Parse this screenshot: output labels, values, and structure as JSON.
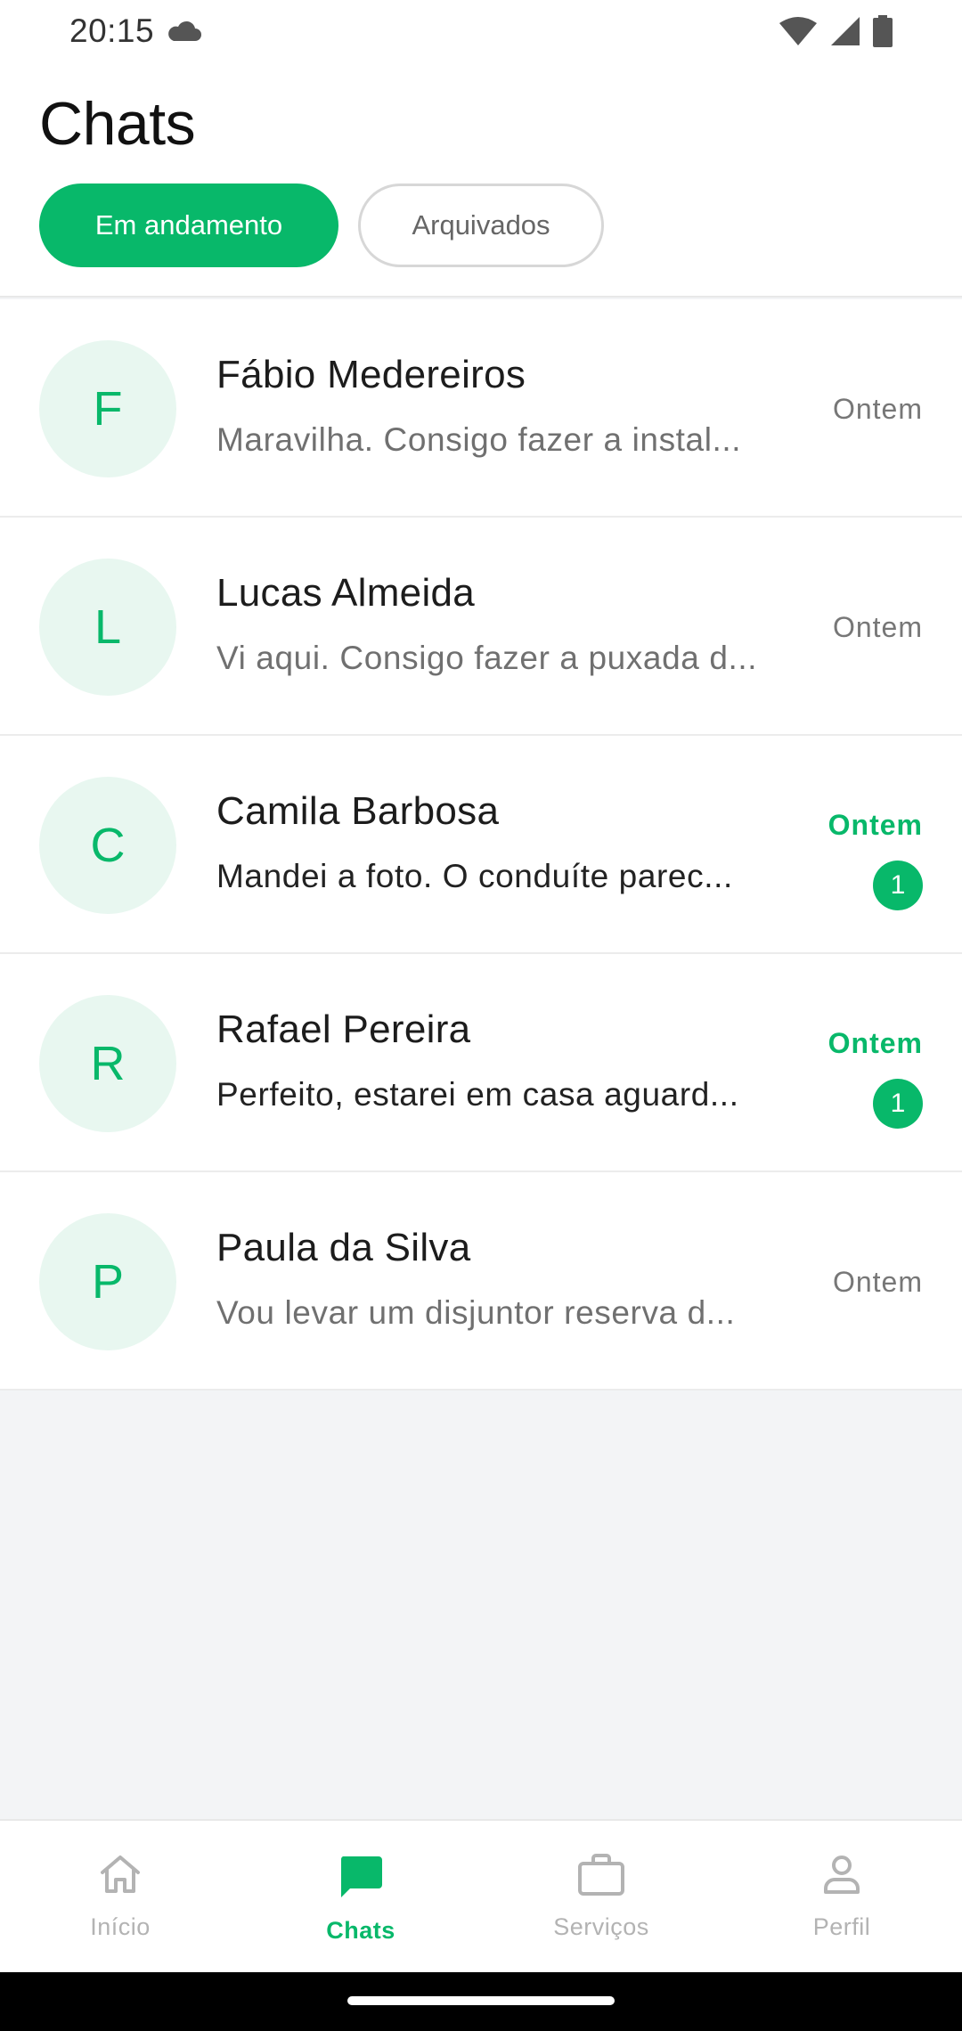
{
  "status_bar": {
    "time": "20:15"
  },
  "header": {
    "title": "Chats",
    "tabs": [
      {
        "label": "Em andamento"
      },
      {
        "label": "Arquivados"
      }
    ]
  },
  "chats": [
    {
      "initial": "F",
      "name": "Fábio Medereiros",
      "preview": "Maravilha. Consigo fazer a instal...",
      "time": "Ontem"
    },
    {
      "initial": "L",
      "name": "Lucas Almeida",
      "preview": "Vi aqui. Consigo fazer a puxada d...",
      "time": "Ontem"
    },
    {
      "initial": "C",
      "name": "Camila Barbosa",
      "preview": "Mandei a foto. O conduíte parec...",
      "time": "Ontem",
      "unread": "1"
    },
    {
      "initial": "R",
      "name": "Rafael Pereira",
      "preview": "Perfeito, estarei em casa aguard...",
      "time": "Ontem",
      "unread": "1"
    },
    {
      "initial": "P",
      "name": "Paula da Silva",
      "preview": "Vou levar um disjuntor reserva d...",
      "time": "Ontem"
    }
  ],
  "bottom_nav": [
    {
      "label": "Início",
      "icon": "home-icon"
    },
    {
      "label": "Chats",
      "icon": "chat-icon"
    },
    {
      "label": "Serviços",
      "icon": "briefcase-icon"
    },
    {
      "label": "Perfil",
      "icon": "profile-icon"
    }
  ],
  "colors": {
    "accent": "#08b86a",
    "avatar_bg": "#e8f7f0",
    "background": "#f3f4f6"
  }
}
